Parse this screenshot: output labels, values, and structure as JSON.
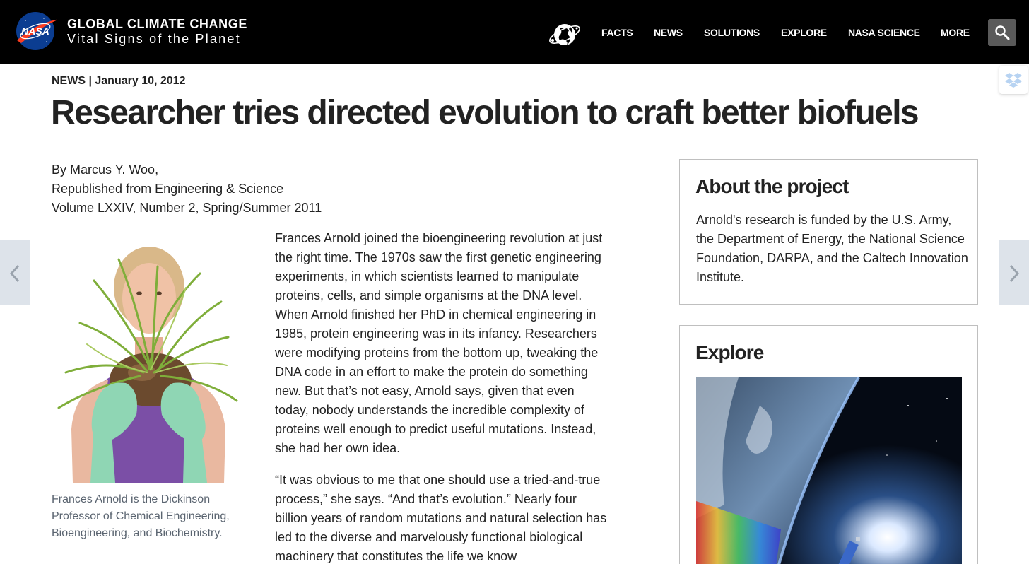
{
  "header": {
    "logo_icon": "nasa-meatball-logo",
    "site_title": "GLOBAL CLIMATE CHANGE",
    "site_subtitle": "Vital Signs of the Planet",
    "globe_icon": "globe-icon",
    "nav": [
      {
        "label": "FACTS"
      },
      {
        "label": "NEWS"
      },
      {
        "label": "SOLUTIONS"
      },
      {
        "label": "EXPLORE"
      },
      {
        "label": "NASA SCIENCE"
      },
      {
        "label": "MORE"
      }
    ],
    "search_icon": "search-icon"
  },
  "article": {
    "kicker": "NEWS | January 10, 2012",
    "title": "Researcher tries directed evolution to craft better biofuels",
    "byline": [
      "By Marcus Y. Woo,",
      "Republished from Engineering & Science",
      "Volume LXXIV, Number 2, Spring/Summer 2011"
    ],
    "photo_caption": "Frances Arnold is the Dickinson Professor of Chemical Engineering, Bioengineering, and Biochemistry.",
    "paragraphs": [
      "Frances Arnold joined the bioengineering revolution at just the right time. The 1970s saw the first genetic engineering experiments, in which scientists learned to manipulate proteins, cells, and simple organisms at the DNA level. When Arnold finished her PhD in chemical engineering in 1985, protein engineering was in its infancy. Researchers were modifying proteins from the bottom up, tweaking the DNA code in an effort to make the protein do something new. But that’s not easy, Arnold says, given that even today, nobody understands the incredible complexity of proteins well enough to predict useful mutations. Instead, she had her own idea.",
      "“It was obvious to me that one should use a tried-and-true process,” she says. “And that’s evolution.” Nearly four billion years of random mutations and natural selection has led to the diverse and marvelously functional biological machinery that constitutes the life we know"
    ]
  },
  "sidebar": {
    "about": {
      "heading": "About the project",
      "text": "Arnold's research is funded by the U.S. Army, the Department of Energy, the National Science Foundation, DARPA, and the Caltech Innovation Institute."
    },
    "explore": {
      "heading": "Explore"
    }
  },
  "controls": {
    "prev_icon": "chevron-left-icon",
    "next_icon": "chevron-right-icon",
    "dropbox_icon": "dropbox-icon"
  },
  "colors": {
    "header_bg": "#000000",
    "caption_text": "#5a6470",
    "arrow_bg": "#dde3ea"
  }
}
